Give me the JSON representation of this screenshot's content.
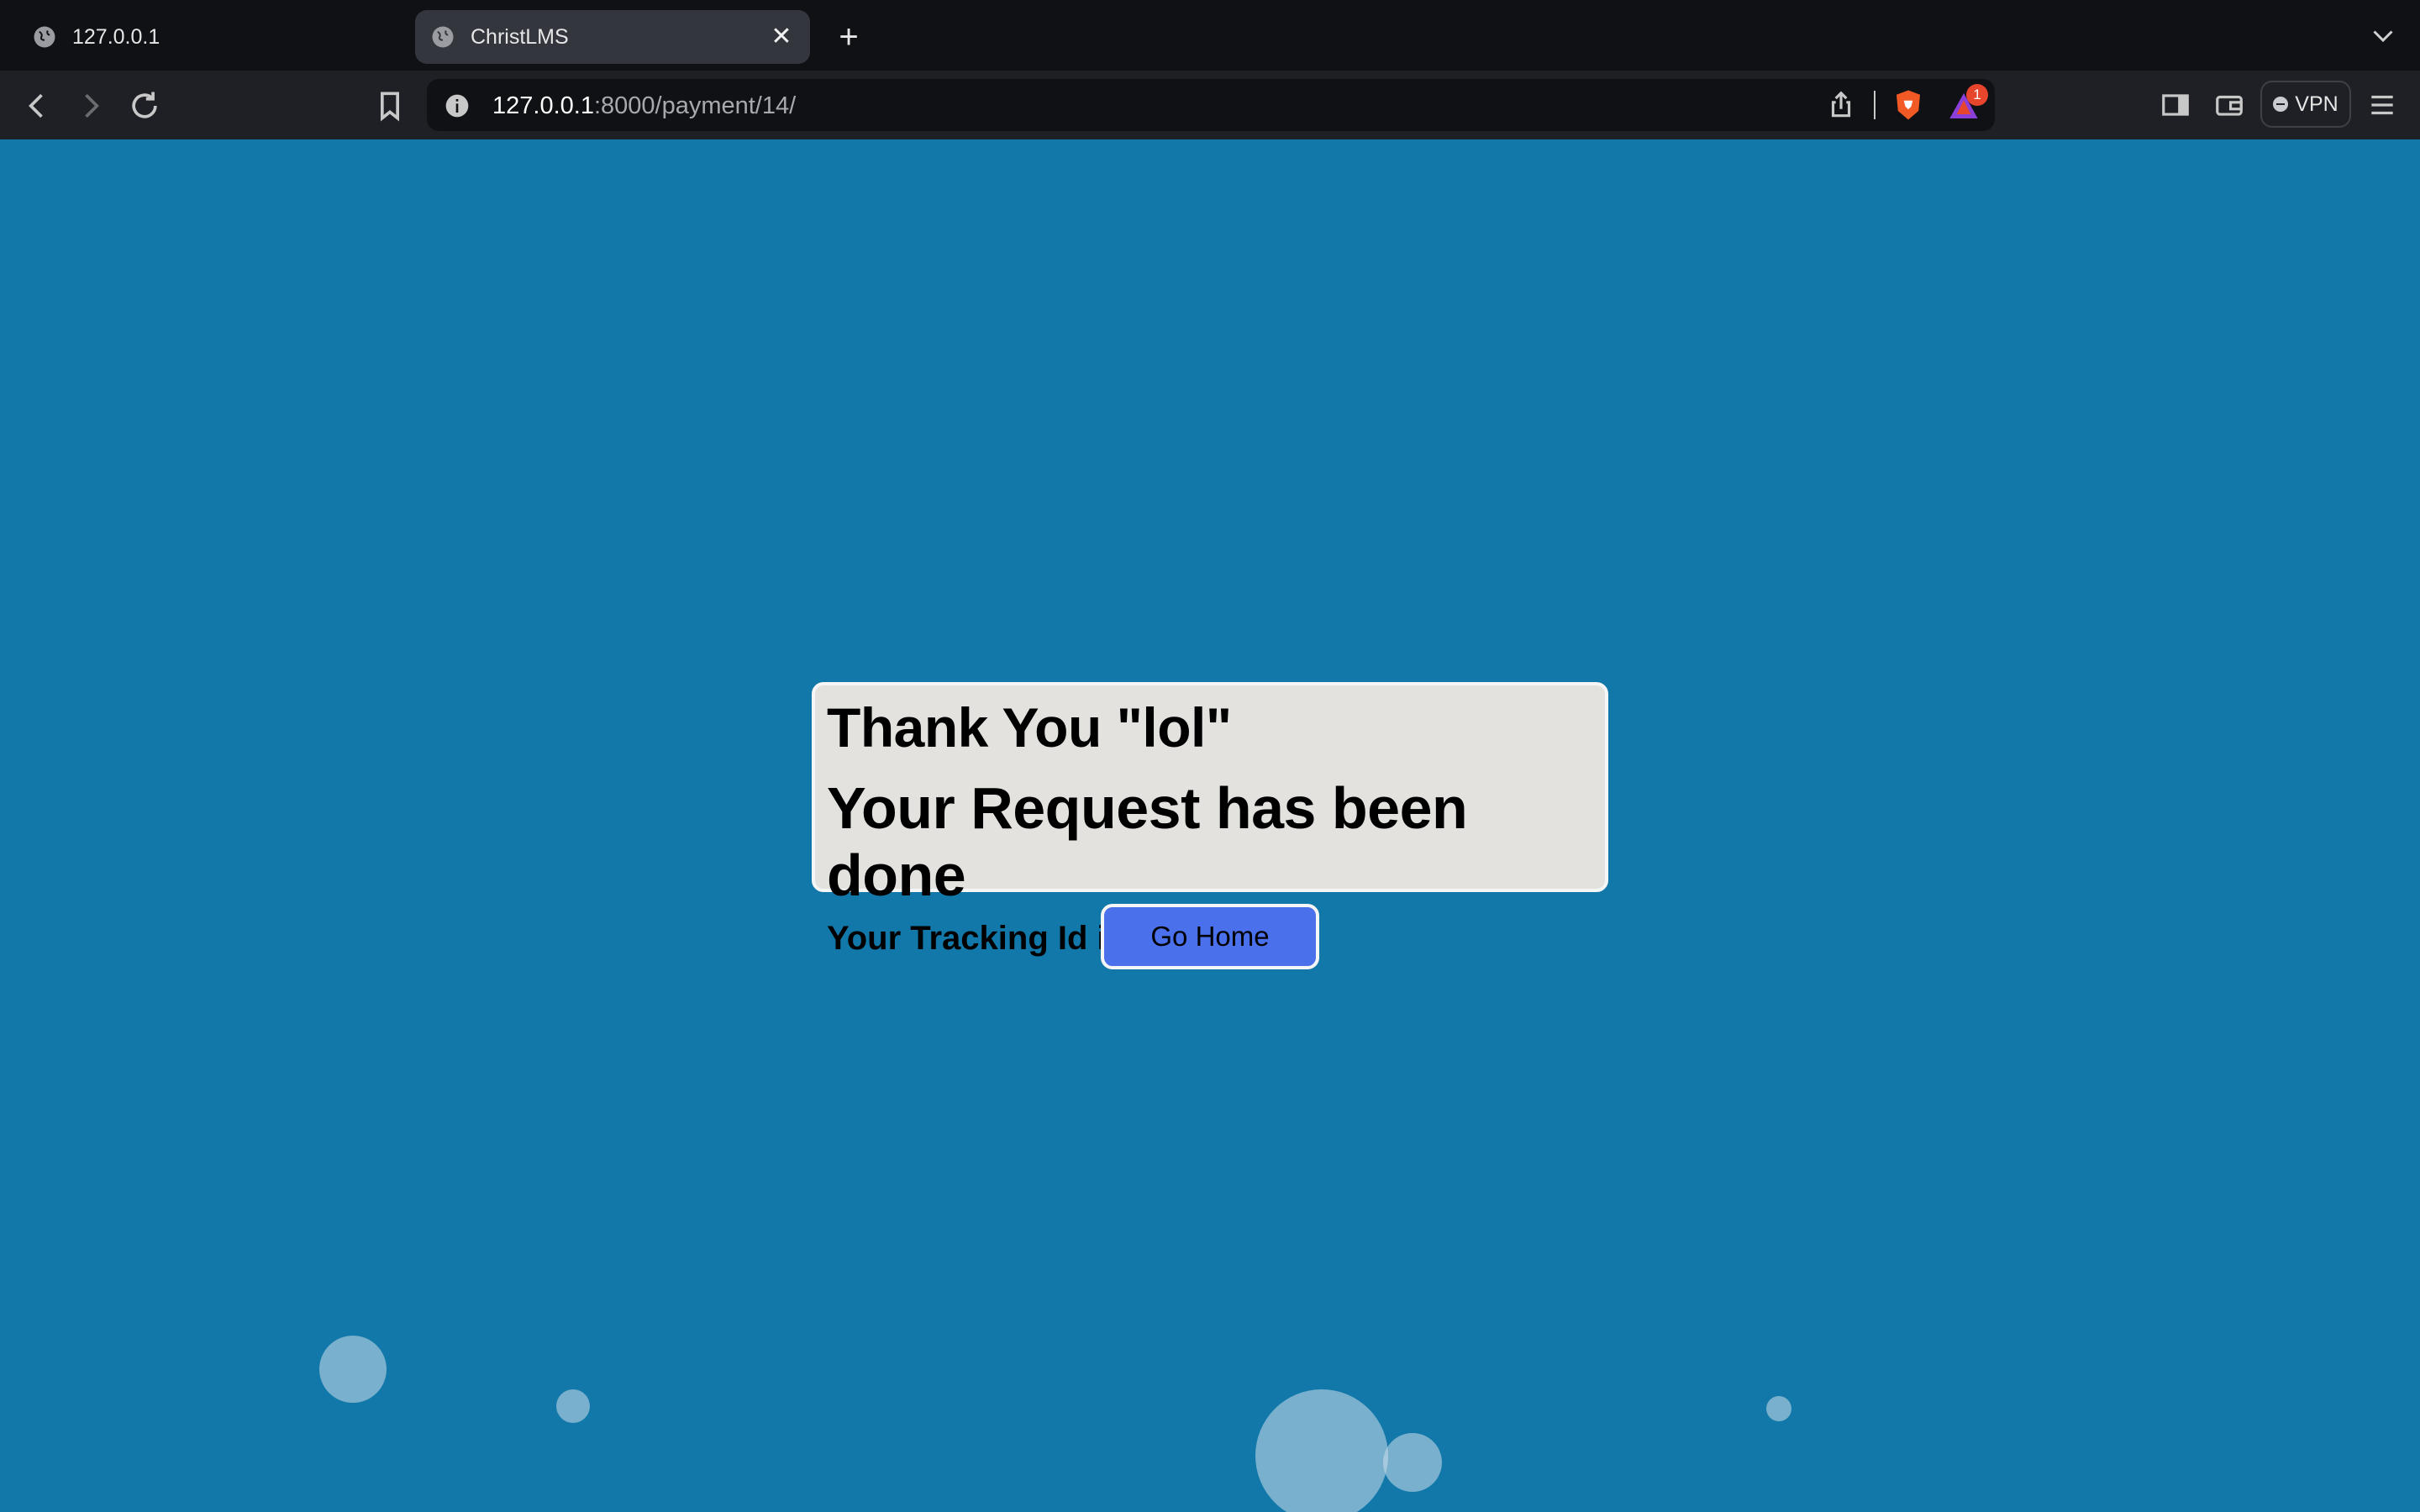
{
  "browser": {
    "tabs": [
      {
        "title": "127.0.0.1",
        "active": false
      },
      {
        "title": "ChristLMS",
        "active": true
      }
    ],
    "new_tab_icon": "plus-icon",
    "address": {
      "host": "127.0.0.1",
      "path": ":8000/payment/14/"
    },
    "vpn_label": "VPN",
    "rewards_badge": "1",
    "colors": {
      "tab_strip": "#0f1115",
      "toolbar": "#1e2025",
      "active_tab": "#33363d"
    }
  },
  "page": {
    "thank_you": "Thank You \"lol\"",
    "request_done": "Your Request has been done",
    "tracking": "Your Tracking Id is 14",
    "go_home_label": "Go Home",
    "colors": {
      "background": "#1178a9",
      "card": "#e4e2df",
      "button": "#4a70ec"
    }
  }
}
